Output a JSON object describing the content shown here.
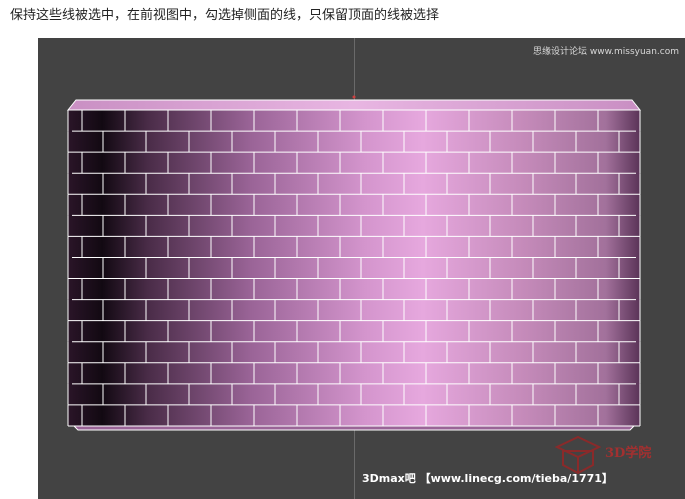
{
  "instruction": "保持这些线被选中，在前视图中，勾选掉侧面的线，只保留顶面的线被选择",
  "viewport": {
    "label": "",
    "watermark_top": "思缘设计论坛 www.missyuan.com",
    "watermark_bottom": "3Dmax吧 【www.linecg.com/tieba/1771】",
    "logo_text": "3D学院"
  },
  "wall": {
    "rows": 15,
    "brick_colors": {
      "left_dark": "#1a0e18",
      "mid_dark": "#7a4a78",
      "highlight": "#e3a6db",
      "right_mid": "#b07aa8",
      "right_edge": "#5a3357"
    },
    "line_color": "#ffffff"
  }
}
